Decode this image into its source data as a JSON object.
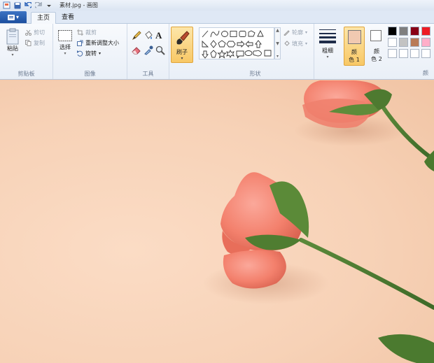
{
  "window": {
    "title": "素材.jpg - 画图"
  },
  "file_menu": {
    "label": "▾"
  },
  "tabs": [
    {
      "label": "主页"
    },
    {
      "label": "查看"
    }
  ],
  "ribbon": {
    "clipboard": {
      "label": "剪贴板",
      "paste": "粘贴",
      "cut": "剪切",
      "copy": "复制"
    },
    "image": {
      "label": "图像",
      "select": "选择",
      "crop": "裁剪",
      "resize": "重新调整大小",
      "rotate": "旋转"
    },
    "tools": {
      "label": "工具"
    },
    "brush": {
      "label": "刷子"
    },
    "shapes": {
      "label": "形状",
      "outline": "轮廓",
      "fill": "填充"
    },
    "size": {
      "label": "粗细"
    },
    "color1": {
      "label_line1": "颜",
      "label_line2": "色 1",
      "value": "#f1c9b1"
    },
    "color2": {
      "label_line1": "颜",
      "label_line2": "色 2",
      "value": "#ffffff"
    },
    "colors": {
      "label": "颜"
    },
    "palette": [
      "#000000",
      "#7f7f7f",
      "#880015",
      "#ed1c24",
      "#ffffff",
      "#c3c3c3",
      "#b97a57",
      "#ffaec9",
      "#ffffff",
      "#ffffff",
      "#ffffff",
      "#ffffff"
    ]
  }
}
